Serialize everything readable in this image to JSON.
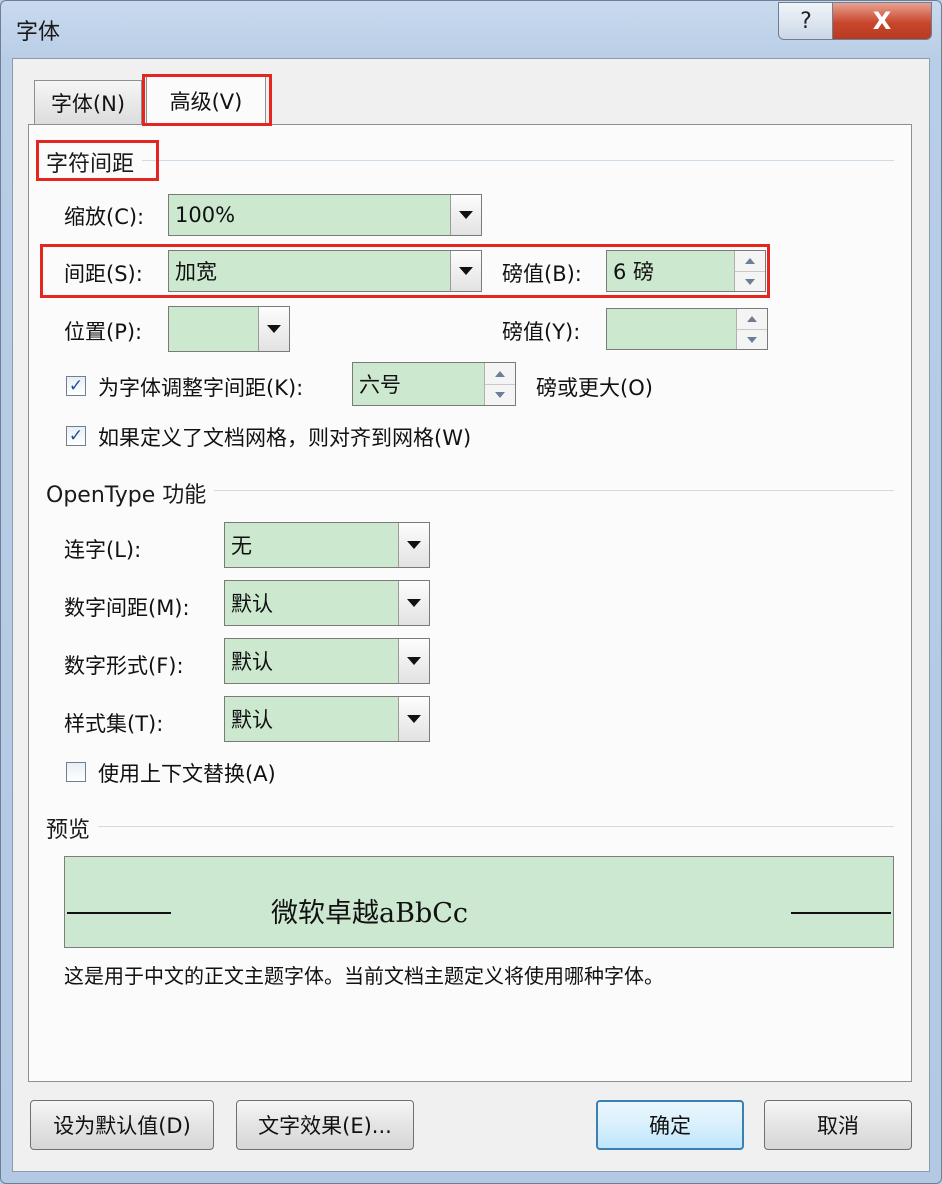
{
  "window": {
    "title": "字体",
    "help_symbol": "?",
    "close_symbol": "X"
  },
  "tabs": [
    {
      "label": "字体(N)"
    },
    {
      "label": "高级(V)"
    }
  ],
  "char_spacing": {
    "heading": "字符间距",
    "scale_label": "缩放(C):",
    "scale_value": "100%",
    "spacing_label": "间距(S):",
    "spacing_value": "加宽",
    "spacing_by_label": "磅值(B):",
    "spacing_by_value": "6 磅",
    "position_label": "位置(P):",
    "position_value": "",
    "position_by_label": "磅值(Y):",
    "position_by_value": "",
    "kerning_checked": true,
    "kerning_label": "为字体调整字间距(K):",
    "kerning_value": "六号",
    "kerning_suffix": "磅或更大(O)",
    "grid_checked": true,
    "grid_label": "如果定义了文档网格，则对齐到网格(W)"
  },
  "opentype": {
    "heading": "OpenType 功能",
    "ligatures_label": "连字(L):",
    "ligatures_value": "无",
    "num_spacing_label": "数字间距(M):",
    "num_spacing_value": "默认",
    "num_forms_label": "数字形式(F):",
    "num_forms_value": "默认",
    "stylistic_label": "样式集(T):",
    "stylistic_value": "默认",
    "contextual_checked": false,
    "contextual_label": "使用上下文替换(A)"
  },
  "preview": {
    "heading": "预览",
    "sample": "微软卓越aBbCc",
    "description": "这是用于中文的正文主题字体。当前文档主题定义将使用哪种字体。"
  },
  "buttons": {
    "set_default": "设为默认值(D)",
    "text_effects": "文字效果(E)...",
    "ok": "确定",
    "cancel": "取消"
  },
  "colors": {
    "field_bg": "#cce8cf",
    "highlight_red": "#e3261f"
  }
}
